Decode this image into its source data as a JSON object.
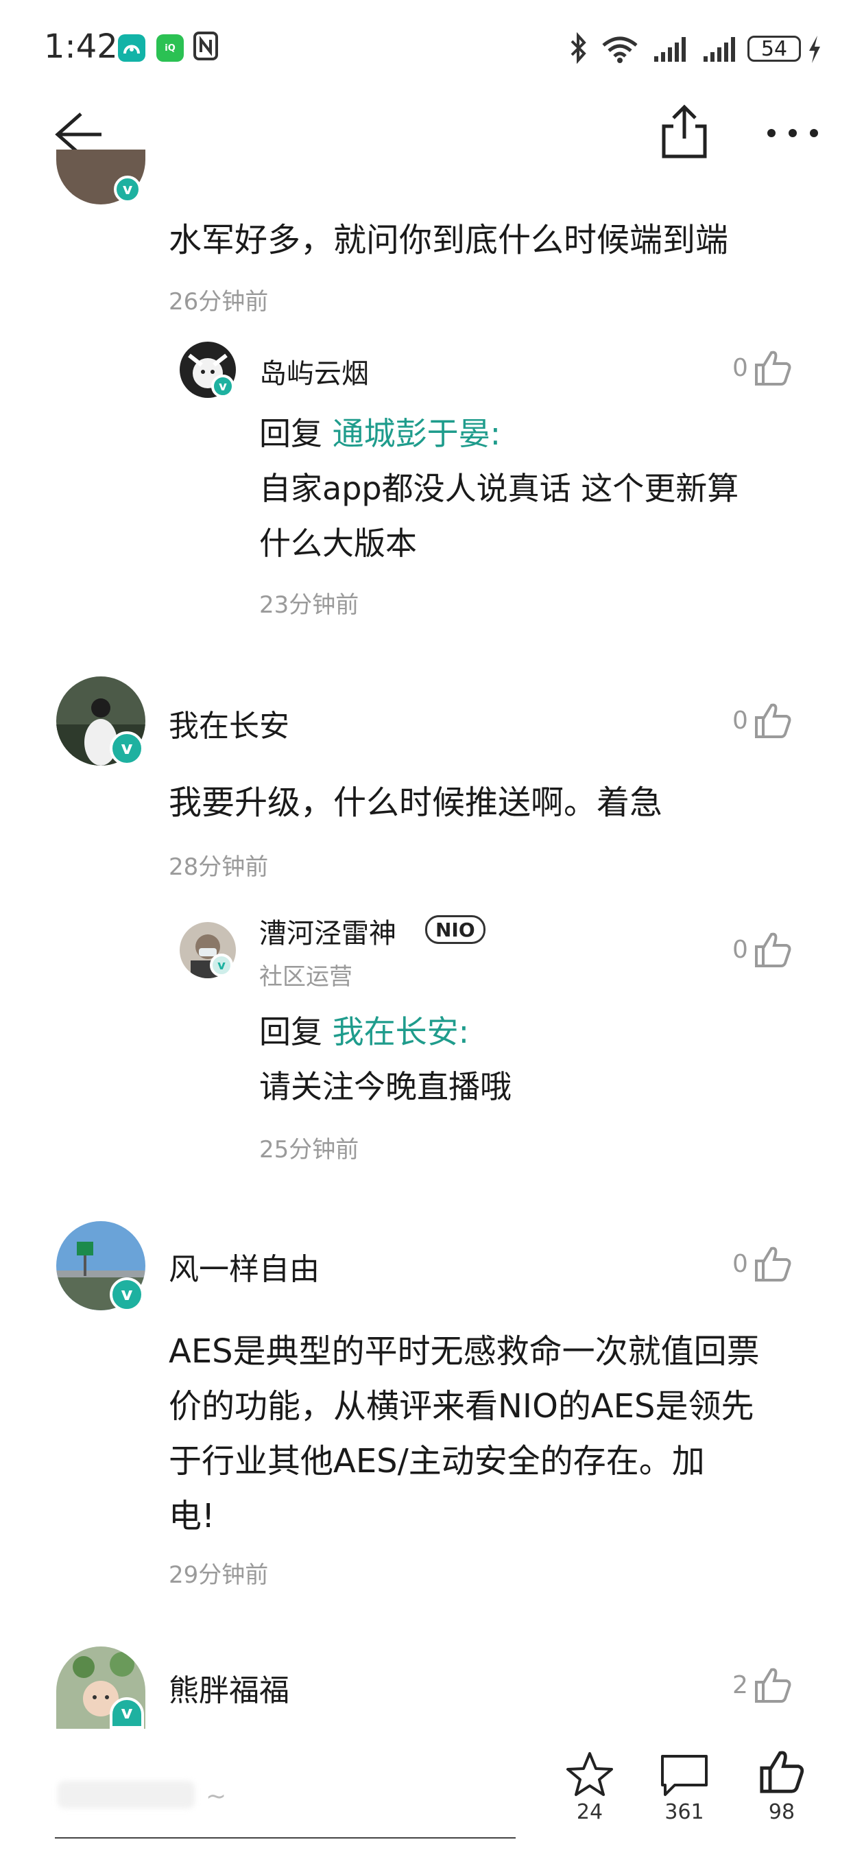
{
  "status_bar": {
    "time": "1:42",
    "battery": "54",
    "app_icons": [
      "nio-icon",
      "iqiyi-icon",
      "nfc-icon"
    ]
  },
  "nav": {
    "icons": [
      "back-arrow-icon",
      "share-icon",
      "more-icon"
    ]
  },
  "comments": [
    {
      "text": "水军好多，就问你到底什么时候端到端",
      "time": "26分钟前",
      "replies": [
        {
          "user": "岛屿云烟",
          "likes": "0",
          "reply_label": "回复",
          "reply_to": "通城彭于晏:",
          "text_line1": "自家app都没人说真话 这个更新算",
          "text_line2": "什么大版本",
          "time": "23分钟前"
        }
      ]
    },
    {
      "user": "我在长安",
      "likes": "0",
      "text": "我要升级，什么时候推送啊。着急",
      "time": "28分钟前",
      "replies": [
        {
          "user": "漕河泾雷神",
          "badge": "NIO",
          "role": "社区运营",
          "likes": "0",
          "reply_label": "回复",
          "reply_to": "我在长安:",
          "text_line1": "请关注今晚直播哦",
          "time": "25分钟前"
        }
      ]
    },
    {
      "user": "风一样自由",
      "likes": "0",
      "text_lines": [
        "AES是典型的平时无感救命一次就值回票",
        "价的功能，从横评来看NIO的AES是领先",
        "于行业其他AES/主动安全的存在。加",
        "电!"
      ],
      "time": "29分钟前"
    },
    {
      "user": "熊胖福福",
      "likes": "2"
    }
  ],
  "bottom_bar": {
    "placeholder": "~",
    "stats": [
      {
        "icon": "star-icon",
        "count": "24"
      },
      {
        "icon": "comment-icon",
        "count": "361"
      },
      {
        "icon": "thumb-up-icon",
        "count": "98"
      }
    ]
  },
  "colors": {
    "accent": "#1f9c8c",
    "verified": "#1eb1a0",
    "muted": "#9a9a9a"
  }
}
